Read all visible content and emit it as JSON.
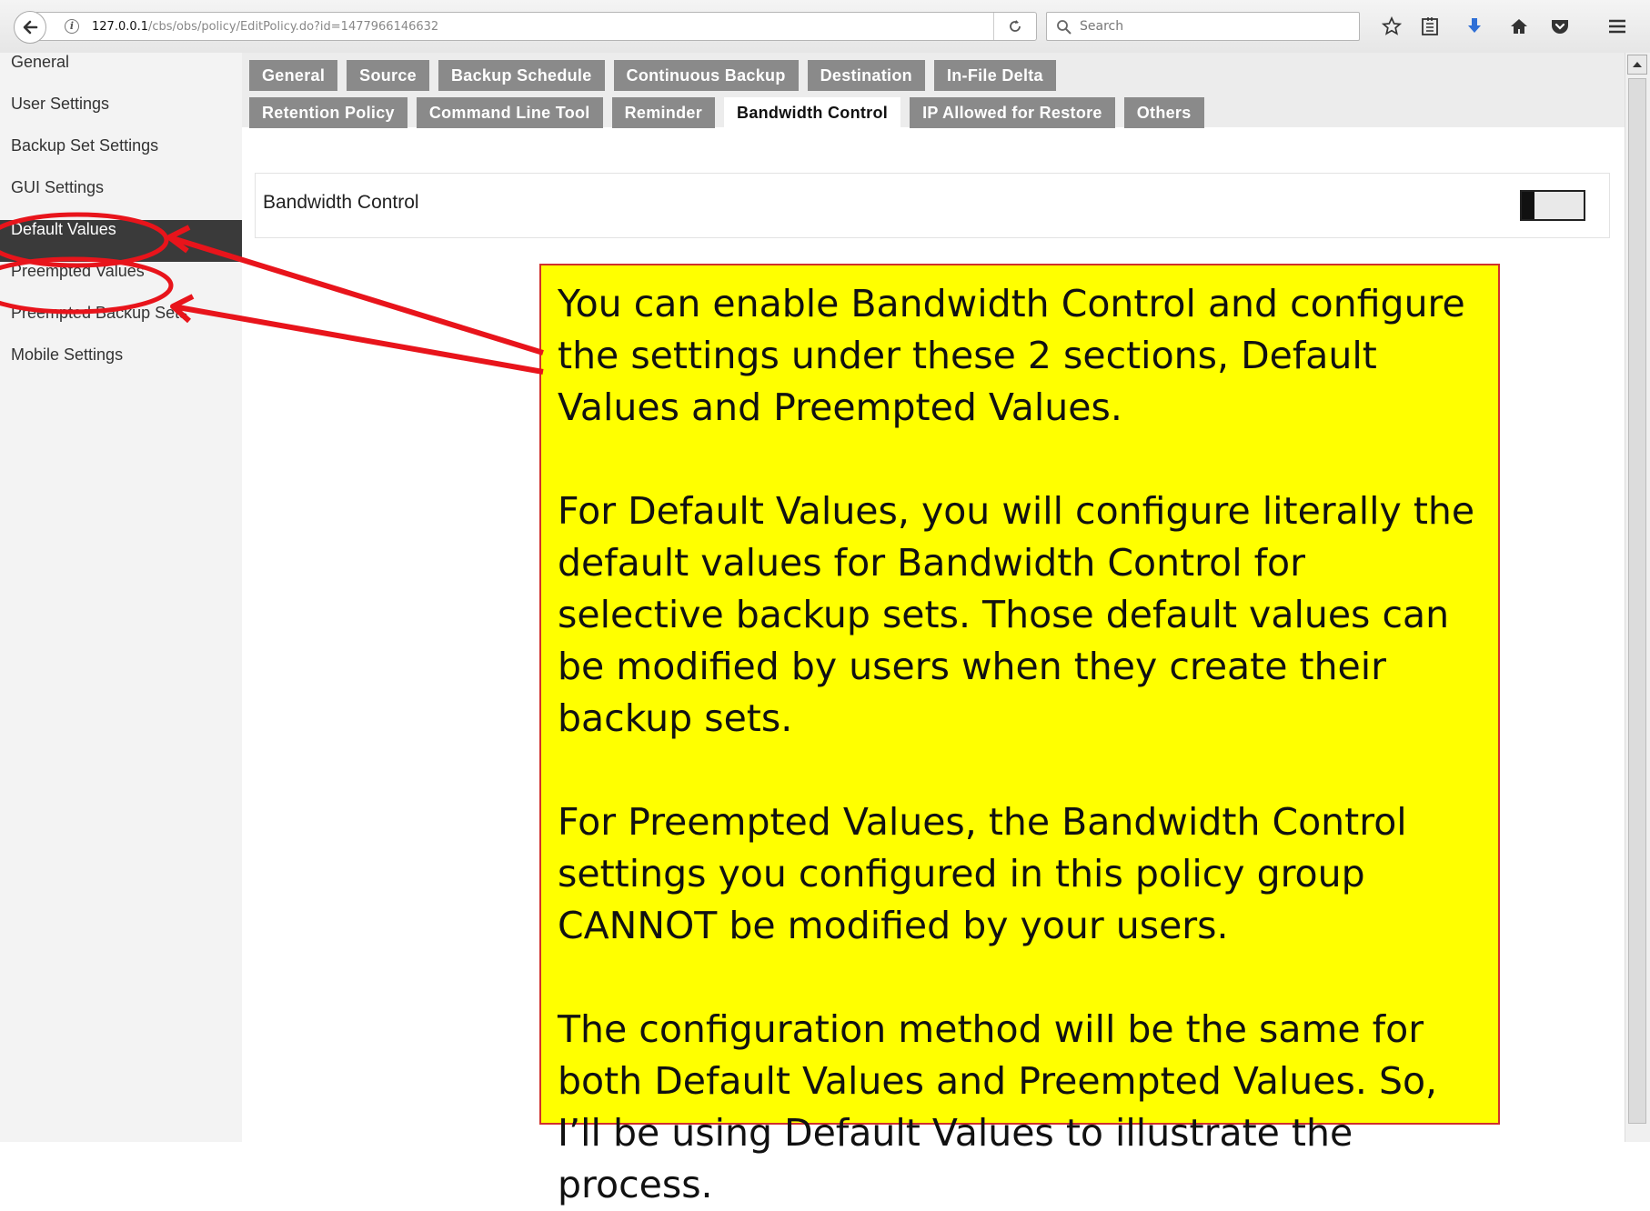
{
  "browser": {
    "url_host": "127.0.0.1",
    "url_path": "/cbs/obs/policy/EditPolicy.do?id=1477966146632",
    "search_placeholder": "Search"
  },
  "sidebar": {
    "items": [
      {
        "label": "General"
      },
      {
        "label": "User Settings"
      },
      {
        "label": "Backup Set Settings"
      },
      {
        "label": "GUI Settings"
      },
      {
        "label": "Default Values",
        "active": true
      },
      {
        "label": "Preempted Values"
      },
      {
        "label": "Preempted Backup Sets"
      },
      {
        "label": "Mobile Settings"
      }
    ]
  },
  "tabs": {
    "row1": [
      "General",
      "Source",
      "Backup Schedule",
      "Continuous Backup",
      "Destination",
      "In-File Delta"
    ],
    "row2": [
      "Retention Policy",
      "Command Line Tool",
      "Reminder",
      "Bandwidth Control",
      "IP Allowed for Restore",
      "Others"
    ],
    "active": "Bandwidth Control"
  },
  "content": {
    "section_title": "Bandwidth Control",
    "toggle_on": false
  },
  "callout": {
    "paragraphs": [
      "You can enable Bandwidth Control and configure the settings under these 2 sections, Default Values and Preempted Values.",
      "For Default Values, you will configure literally the default values for Bandwidth Control for selective backup sets. Those default values can be modified by users when they create their backup sets.",
      "For Preempted Values, the Bandwidth Control settings you configured in this policy group CANNOT be modified by your users.",
      "The configuration method will be the same for both Default Values and Preempted Values. So, I’ll be using Default Values to illustrate the process."
    ]
  },
  "colors": {
    "callout_bg": "#ffff00",
    "annotation": "#e8141b",
    "sidebar_active_bg": "#3a3a3a",
    "tab_bg": "#8a8a8a"
  }
}
